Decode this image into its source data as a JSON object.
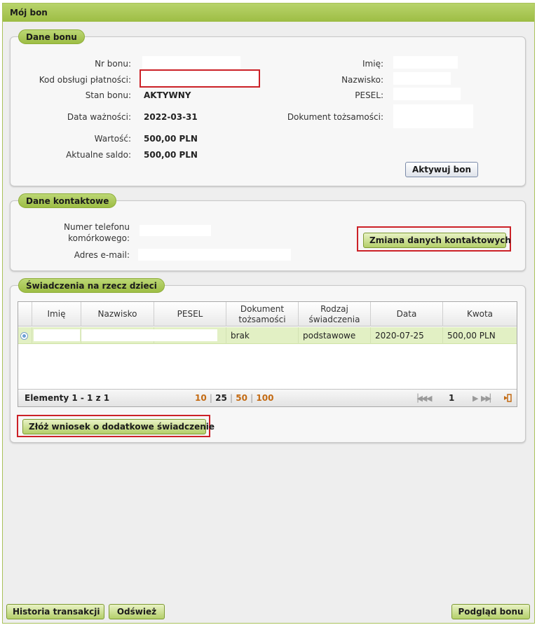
{
  "window": {
    "title": "Mój bon"
  },
  "voucher": {
    "legend": "Dane bonu",
    "nr_label": "Nr bonu:",
    "code_label": "Kod obsługi płatności:",
    "state_label": "Stan bonu:",
    "state_value": "AKTYWNY",
    "validity_label": "Data ważności:",
    "validity_value": "2022-03-31",
    "value_label": "Wartość:",
    "value_value": "500,00 PLN",
    "balance_label": "Aktualne saldo:",
    "balance_value": "500,00 PLN",
    "first_name_label": "Imię:",
    "last_name_label": "Nazwisko:",
    "pesel_label": "PESEL:",
    "id_doc_label": "Dokument tożsamości:",
    "activate_button": "Aktywuj bon"
  },
  "contact": {
    "legend": "Dane kontaktowe",
    "phone_label_line1": "Numer telefonu",
    "phone_label_line2": "komórkowego:",
    "email_label": "Adres e-mail:",
    "change_button": "Zmiana danych kontaktowych"
  },
  "benefits": {
    "legend": "Świadczenia na rzecz dzieci",
    "columns": {
      "first_name": "Imię",
      "last_name": "Nazwisko",
      "pesel": "PESEL",
      "doc_line1": "Dokument",
      "doc_line2": "tożsamości",
      "type_line1": "Rodzaj",
      "type_line2": "świadczenia",
      "date": "Data",
      "amount": "Kwota"
    },
    "rows": [
      {
        "doc": "brak",
        "type": "podstawowe",
        "date": "2020-07-25",
        "amount": "500,00 PLN"
      }
    ],
    "footer": {
      "items_text": "Elementy 1 - 1 z 1",
      "page_sizes": [
        "10",
        "25",
        "50",
        "100"
      ],
      "separator": "|",
      "current_page": "1"
    },
    "apply_button": "Złóż wniosek o dodatkowe świadczenie"
  },
  "bottom": {
    "history_button": "Historia transakcji",
    "refresh_button": "Odśwież",
    "preview_button": "Podgląd bonu"
  },
  "colors": {
    "accent_green": "#9dbd44",
    "highlight_red": "#cc2127",
    "link_orange": "#c36a12",
    "row_selected": "#e2f0c4"
  }
}
